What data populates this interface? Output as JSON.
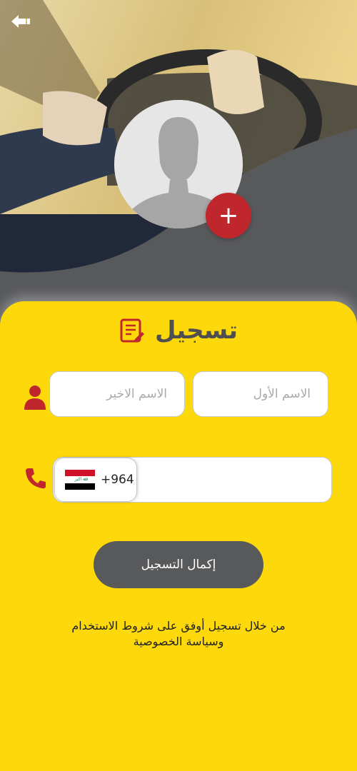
{
  "header": {
    "back_icon": "arrow-left-icon",
    "avatar_icon": "user-placeholder-icon",
    "add_photo_label": "+"
  },
  "form": {
    "title": "تسجيل",
    "title_icon": "registration-form-icon",
    "first_name_placeholder": "الاسم الأول",
    "last_name_placeholder": "الاسم الاخير",
    "name_icon": "person-icon",
    "phone_icon": "phone-icon",
    "country": {
      "flag": "iraq-flag-icon",
      "dial_code": "+964"
    },
    "phone_value": "",
    "submit_label": "إكمال التسجيل"
  },
  "terms": {
    "line1": "من خلال تسجيل أوفق على  شروط الاستخدام",
    "line2": "وسياسة الخصوصية"
  },
  "colors": {
    "background": "#fdd80a",
    "accent_red": "#c0272d",
    "button_gray": "#58595b",
    "title_gray": "#4f4f4f"
  }
}
